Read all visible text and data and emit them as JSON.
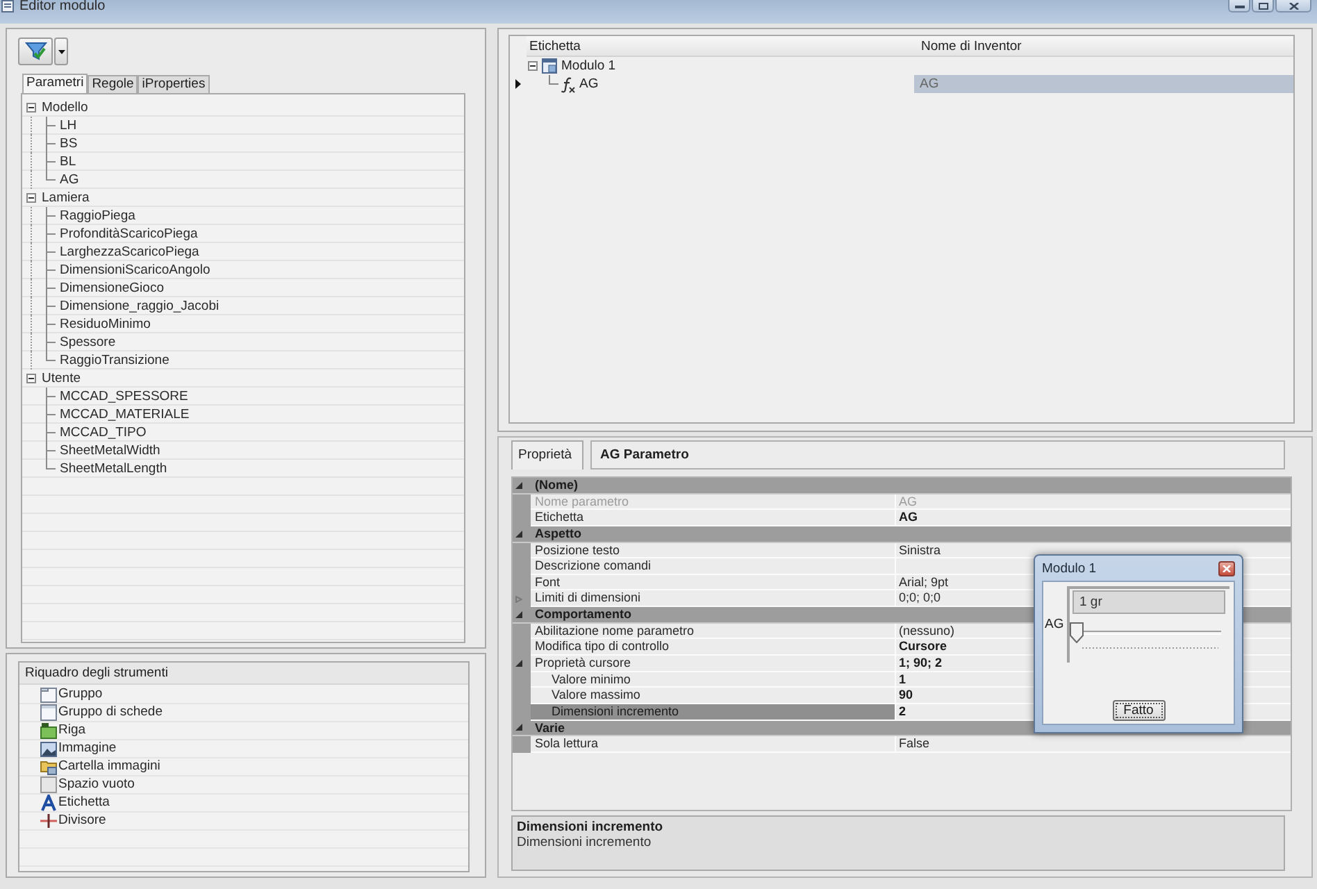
{
  "window": {
    "title": "Editor modulo"
  },
  "parameter_tabs": [
    {
      "label": "Parametri",
      "selected": true
    },
    {
      "label": "Regole",
      "selected": false
    },
    {
      "label": "iProperties",
      "selected": false
    }
  ],
  "parameter_tree": [
    {
      "label": "Modello",
      "expanded": true,
      "children": [
        {
          "label": "LH"
        },
        {
          "label": "BS"
        },
        {
          "label": "BL"
        },
        {
          "label": "AG"
        }
      ]
    },
    {
      "label": "Lamiera",
      "expanded": true,
      "children": [
        {
          "label": "RaggioPiega"
        },
        {
          "label": "ProfonditàScaricoPiega"
        },
        {
          "label": "LarghezzaScaricoPiega"
        },
        {
          "label": "DimensioniScaricoAngolo"
        },
        {
          "label": "DimensioneGioco"
        },
        {
          "label": "Dimensione_raggio_Jacobi"
        },
        {
          "label": "ResiduoMinimo"
        },
        {
          "label": "Spessore"
        },
        {
          "label": "RaggioTransizione"
        }
      ]
    },
    {
      "label": "Utente",
      "expanded": true,
      "children": [
        {
          "label": "MCCAD_SPESSORE"
        },
        {
          "label": "MCCAD_MATERIALE"
        },
        {
          "label": "MCCAD_TIPO"
        },
        {
          "label": "SheetMetalWidth"
        },
        {
          "label": "SheetMetalLength"
        }
      ]
    }
  ],
  "toolbox": {
    "title": "Riquadro degli strumenti",
    "items": [
      {
        "label": "Gruppo",
        "kind": "group"
      },
      {
        "label": "Gruppo di schede",
        "kind": "tab_group"
      },
      {
        "label": "Riga",
        "kind": "row"
      },
      {
        "label": "Immagine",
        "kind": "picture"
      },
      {
        "label": "Cartella immagini",
        "kind": "picture_folder"
      },
      {
        "label": "Spazio vuoto",
        "kind": "empty_space"
      },
      {
        "label": "Etichetta",
        "kind": "label"
      },
      {
        "label": "Divisore",
        "kind": "splitter"
      }
    ]
  },
  "form_tree": {
    "columns": [
      "Etichetta",
      "Nome di Inventor"
    ],
    "rows": [
      {
        "label": "Modulo 1",
        "kind": "form",
        "expanded": true,
        "selected": false,
        "children": [
          {
            "label": "AG",
            "kind": "parameter",
            "inventor_name": "AG",
            "selected": true
          }
        ]
      }
    ]
  },
  "properties": {
    "tab": "Proprietà",
    "object": "AG Parametro",
    "categories": [
      {
        "name": "(Nome)",
        "expanded": true,
        "rows": [
          {
            "name": "Nome parametro",
            "value": "AG",
            "disabled": true,
            "modified": false,
            "selected": false
          },
          {
            "name": "Etichetta",
            "value": "AG",
            "disabled": false,
            "modified": true,
            "selected": false
          }
        ]
      },
      {
        "name": "Aspetto",
        "expanded": true,
        "rows": [
          {
            "name": "Posizione testo",
            "value": "Sinistra",
            "disabled": false,
            "modified": false,
            "selected": false
          },
          {
            "name": "Descrizione comandi",
            "disabled": false,
            "selected": false
          },
          {
            "name": "Font",
            "value": "Arial; 9pt",
            "disabled": false,
            "modified": false,
            "selected": false
          },
          {
            "name": "Limiti di dimensioni",
            "value": "0;0; 0;0",
            "disabled": false,
            "modified": false,
            "selected": false,
            "expanded": false
          }
        ]
      },
      {
        "name": "Comportamento",
        "expanded": true,
        "rows": [
          {
            "name": "Abilitazione nome parametro",
            "value": "(nessuno)",
            "disabled": false,
            "modified": false,
            "selected": false
          },
          {
            "name": "Modifica tipo di controllo",
            "value": "Cursore",
            "disabled": false,
            "modified": true,
            "selected": false
          },
          {
            "name": "Proprietà cursore",
            "value": "1; 90; 2",
            "disabled": false,
            "modified": true,
            "selected": false,
            "expanded": true,
            "children": [
              {
                "name": "Valore minimo",
                "value": "1",
                "disabled": false,
                "modified": true,
                "selected": false
              },
              {
                "name": "Valore massimo",
                "value": "90",
                "disabled": false,
                "modified": true,
                "selected": false
              },
              {
                "name": "Dimensioni incremento",
                "value": "2",
                "disabled": false,
                "modified": true,
                "selected": true
              }
            ]
          }
        ]
      },
      {
        "name": "Varie",
        "expanded": true,
        "rows": [
          {
            "name": "Sola lettura",
            "value": "False",
            "disabled": false,
            "modified": false,
            "selected": false
          }
        ]
      }
    ]
  },
  "description": {
    "title": "Dimensioni incremento",
    "text": "Dimensioni incremento"
  },
  "dialog": {
    "title": "Modulo 1",
    "value": "1 gr",
    "label": "AG",
    "slider": {
      "level": 0
    },
    "button": "Fatto"
  }
}
